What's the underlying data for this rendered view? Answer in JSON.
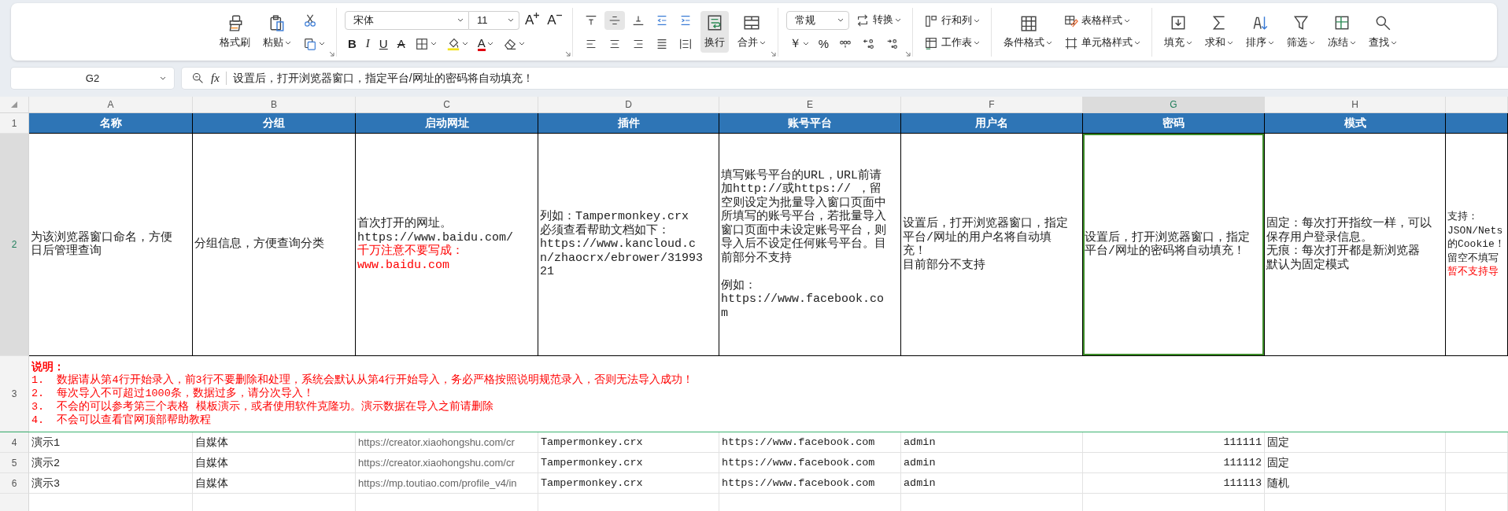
{
  "ribbon": {
    "clipboard": {
      "buttons": [
        {
          "label": "格式刷",
          "kind": "brush",
          "caret": false
        },
        {
          "label": "粘贴",
          "kind": "paste",
          "caret": true
        }
      ],
      "small": [
        {
          "kind": "cut",
          "caret": false
        },
        {
          "kind": "copy",
          "caret": true
        }
      ]
    },
    "font": {
      "name": "宋体",
      "size": "11",
      "size_buttons": [
        {
          "label": "A",
          "kind": "grow"
        },
        {
          "label": "A",
          "kind": "shrink"
        }
      ],
      "tools": [
        {
          "kind": "bold",
          "label": "B",
          "caret": false
        },
        {
          "kind": "italic",
          "label": "I",
          "caret": false
        },
        {
          "kind": "underline",
          "label": "U",
          "caret": false
        },
        {
          "kind": "strike",
          "label": "A",
          "caret": false
        },
        {
          "kind": "border",
          "caret": true
        },
        {
          "kind": "fill",
          "caret": true
        },
        {
          "kind": "font-color",
          "label": "A",
          "caret": true
        },
        {
          "kind": "eraser",
          "caret": true
        }
      ]
    },
    "alignment": {
      "top": [
        {
          "kind": "align-top",
          "selected": false
        },
        {
          "kind": "align-middle",
          "selected": true
        },
        {
          "kind": "align-bottom",
          "selected": false
        },
        {
          "kind": "outdent",
          "selected": false
        },
        {
          "kind": "indent",
          "selected": false
        }
      ],
      "bottom": [
        {
          "kind": "align-left",
          "selected": false
        },
        {
          "kind": "align-center",
          "selected": false
        },
        {
          "kind": "align-right",
          "selected": false
        },
        {
          "kind": "justify",
          "selected": false
        },
        {
          "kind": "distribute",
          "selected": false
        }
      ],
      "wrap": {
        "label": "换行",
        "kind": "wrap",
        "selected": true
      },
      "merge": {
        "label": "合并",
        "kind": "merge",
        "caret": true
      }
    },
    "number": {
      "format": "常规",
      "convert": {
        "label": "转换",
        "kind": "convert",
        "caret": true
      },
      "tools": [
        {
          "kind": "currency",
          "label": "￥",
          "caret": true
        },
        {
          "kind": "percent",
          "label": "%",
          "caret": false
        },
        {
          "kind": "thousands",
          "caret": false
        },
        {
          "kind": "decimal-more",
          "caret": false
        },
        {
          "kind": "decimal-less",
          "caret": false
        }
      ]
    },
    "cells": [
      {
        "label": "行和列",
        "kind": "rows-cols",
        "caret": true
      },
      {
        "label": "工作表",
        "kind": "sheet",
        "caret": true
      }
    ],
    "styles": {
      "big": {
        "label": "条件格式",
        "kind": "conditional",
        "caret": true
      },
      "small": [
        {
          "label": "表格样式",
          "kind": "table-style",
          "caret": true
        },
        {
          "label": "单元格样式",
          "kind": "cell-style",
          "caret": true
        }
      ]
    },
    "editing": [
      {
        "label": "填充",
        "kind": "fill-down",
        "caret": true
      },
      {
        "label": "求和",
        "kind": "sum",
        "caret": true
      },
      {
        "label": "排序",
        "kind": "sort",
        "caret": true
      },
      {
        "label": "筛选",
        "kind": "filter",
        "caret": true
      },
      {
        "label": "冻结",
        "kind": "freeze",
        "caret": true
      },
      {
        "label": "查找",
        "kind": "find",
        "caret": true
      }
    ]
  },
  "formula_bar": {
    "name_box": "G2",
    "fx": "fx",
    "formula": "设置后，打开浏览器窗口，指定平台/网址的密码将自动填充！"
  },
  "sheet": {
    "columns": [
      {
        "letter": "A",
        "selected": false
      },
      {
        "letter": "B",
        "selected": false
      },
      {
        "letter": "C",
        "selected": false
      },
      {
        "letter": "D",
        "selected": false
      },
      {
        "letter": "E",
        "selected": false
      },
      {
        "letter": "F",
        "selected": false
      },
      {
        "letter": "G",
        "selected": true
      },
      {
        "letter": "H",
        "selected": false
      },
      {
        "selected": false
      }
    ],
    "header_row": {
      "number": "1",
      "selected": false,
      "cells": [
        "名称",
        "分组",
        "启动网址",
        "插件",
        "账号平台",
        "用户名",
        "密码",
        "模式"
      ]
    },
    "description_row": {
      "number": "2",
      "selected": true,
      "cells": [
        {
          "blocks": [
            [
              "为该浏览器窗口命名，方便日后管理查询"
            ]
          ],
          "selected": false
        },
        {
          "blocks": [
            [
              "分组信息，方便查询分类"
            ]
          ],
          "selected": false
        },
        {
          "blocks": [
            [
              "首次打开的网址。",
              "https://www.baidu.com/"
            ]
          ],
          "warning": [
            "千万注意不要写成：",
            "www.baidu.com"
          ],
          "selected": false
        },
        {
          "blocks": [
            [
              "列如：Tampermonkey.crx",
              "必须查看帮助文档如下：",
              "https://www.kancloud.cn/zhaocrx/ebrower/3199321"
            ]
          ],
          "selected": false
        },
        {
          "blocks": [
            [
              "填写账号平台的URL，URL前请加http://或https:// ，留空则设定为批量导入窗口页面中所填写的账号平台，若批量导入窗口页面中未设定账号平台，则导入后不设定任何账号平台。目前部分不支持"
            ],
            [
              "例如：",
              "https://www.facebook.com"
            ]
          ],
          "selected": false
        },
        {
          "blocks": [
            [
              "设置后，打开浏览器窗口，指定平台/网址的用户名将自动填充！",
              "目前部分不支持"
            ]
          ],
          "selected": false
        },
        {
          "blocks": [
            [
              "设置后，打开浏览器窗口，指定平台/网址的密码将自动填充！"
            ]
          ],
          "selected": true
        },
        {
          "blocks": [
            [
              "固定：每次打开指纹一样，可以保存用户登录信息。",
              "无痕：每次打开都是新浏览器",
              "默认为固定模式"
            ]
          ],
          "selected": false
        },
        {
          "blocks": [
            [
              "支持：",
              "JSON/Nets",
              "的Cookie！",
              "留空不填写"
            ]
          ],
          "warning": [
            "暂不支持导"
          ],
          "selected": false
        }
      ]
    },
    "notes_row": {
      "number": "3",
      "selected": false,
      "title": "说明：",
      "lines": [
        "1.  数据请从第4行开始录入，前3行不要删除和处理，系统会默认从第4行开始导入，务必严格按照说明规范录入，否则无法导入成功！",
        "2.  每次导入不可超过1000条，数据过多，请分次导入！",
        "3.  不会的可以参考第三个表格 模板演示，或者使用软件克隆功。演示数据在导入之前请删除",
        "4.  不会可以查看官网顶部帮助教程"
      ]
    },
    "data_rows": [
      {
        "number": "4",
        "selected": false,
        "cells": [
          {
            "text": "演示1",
            "kind": "text"
          },
          {
            "text": "自媒体",
            "kind": "text"
          },
          {
            "text": "https://creator.xiaohongshu.com/cr",
            "kind": "url"
          },
          {
            "text": "Tampermonkey.crx",
            "kind": "text"
          },
          {
            "text": "https://www.facebook.com",
            "kind": "text"
          },
          {
            "text": "admin",
            "kind": "text"
          },
          {
            "text": "111111",
            "kind": "number"
          },
          {
            "text": "固定",
            "kind": "text"
          }
        ]
      },
      {
        "number": "5",
        "selected": false,
        "cells": [
          {
            "text": "演示2",
            "kind": "text"
          },
          {
            "text": "自媒体",
            "kind": "text"
          },
          {
            "text": "https://creator.xiaohongshu.com/cr",
            "kind": "url"
          },
          {
            "text": "Tampermonkey.crx",
            "kind": "text"
          },
          {
            "text": "https://www.facebook.com",
            "kind": "text"
          },
          {
            "text": "admin",
            "kind": "text"
          },
          {
            "text": "111112",
            "kind": "number"
          },
          {
            "text": "固定",
            "kind": "text"
          }
        ]
      },
      {
        "number": "6",
        "selected": false,
        "cells": [
          {
            "text": "演示3",
            "kind": "text"
          },
          {
            "text": "自媒体",
            "kind": "text"
          },
          {
            "text": "https://mp.toutiao.com/profile_v4/in",
            "kind": "url"
          },
          {
            "text": "Tampermonkey.crx",
            "kind": "text"
          },
          {
            "text": "https://www.facebook.com",
            "kind": "text"
          },
          {
            "text": "admin",
            "kind": "text"
          },
          {
            "text": "111113",
            "kind": "number"
          },
          {
            "text": "随机",
            "kind": "text"
          }
        ]
      }
    ]
  }
}
